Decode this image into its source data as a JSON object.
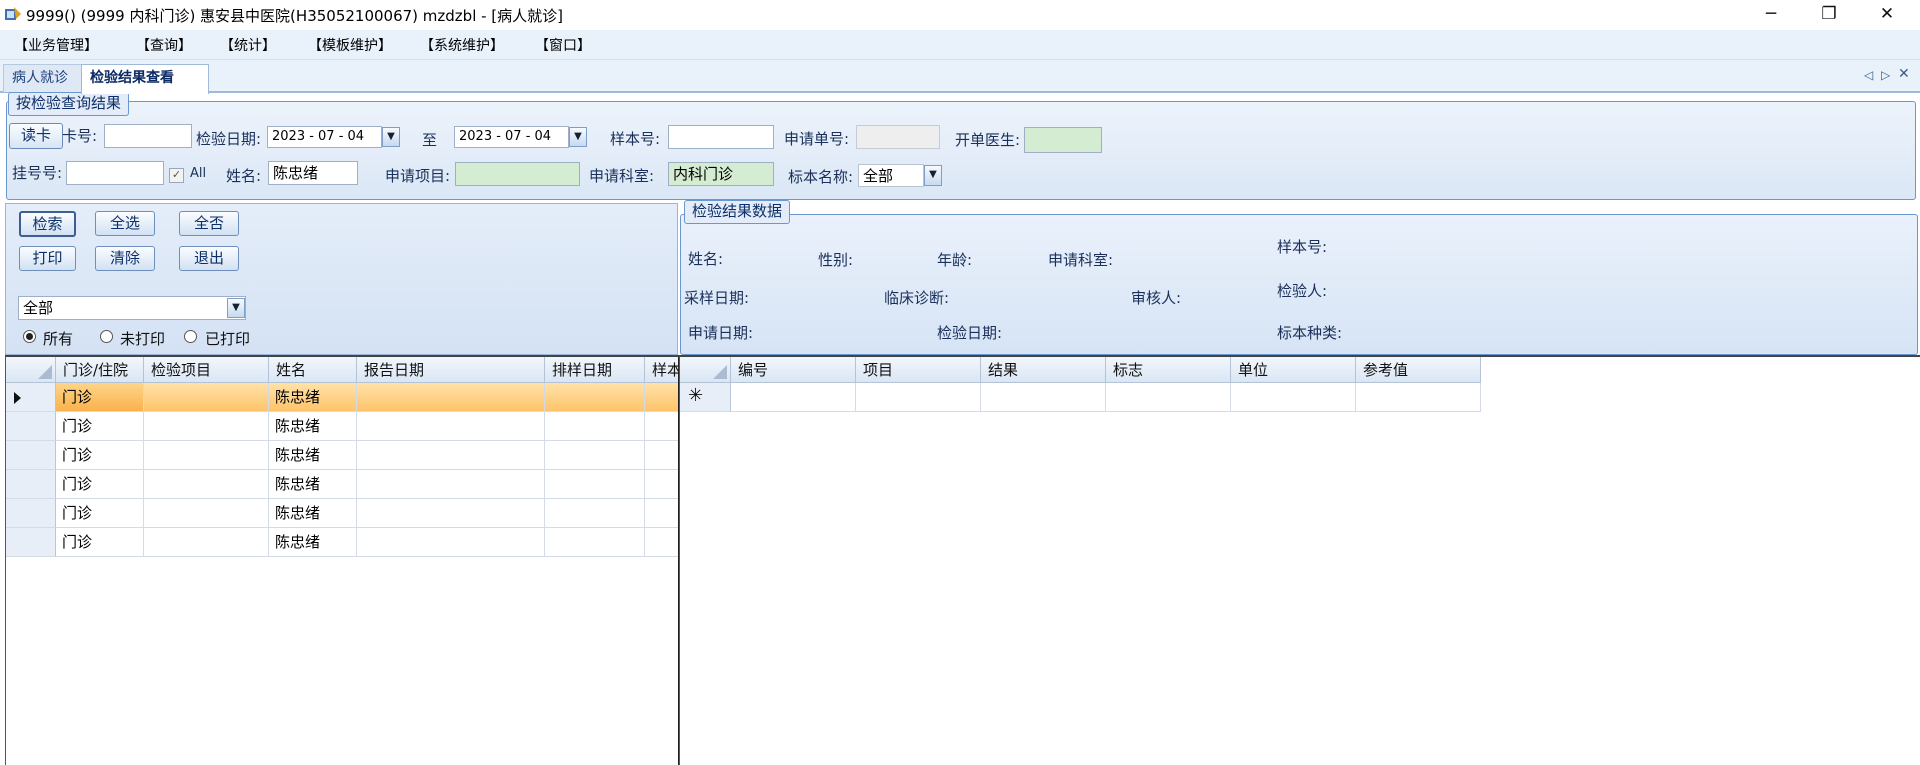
{
  "window": {
    "title": "9999() (9999 内科门诊) 惠安县中医院(H35052100067) mzdzbl - [病人就诊]",
    "minimize_glyph": "─",
    "restore_glyph": "❐",
    "close_glyph": "✕"
  },
  "menu": [
    "【业务管理】",
    "【查询】",
    "【统计】",
    "【模板维护】",
    "【系统维护】",
    "【窗口】"
  ],
  "tabs": {
    "items": [
      "病人就诊",
      "检验结果查看"
    ],
    "active": "检验结果查看",
    "prev_glyph": "◁",
    "next_glyph": "▷",
    "close_glyph": "✕"
  },
  "query": {
    "legend": "按检验查询结果",
    "read_card_label": "读卡",
    "card_no_label": "卡号:",
    "card_no_value": "",
    "date_label": "检验日期:",
    "date_from": "2023 - 07 - 04",
    "to_label": "至",
    "date_to": "2023 - 07 - 04",
    "sample_no_label": "样本号:",
    "sample_no_value": "",
    "request_no_label": "申请单号:",
    "request_no_value": "",
    "doctor_label": "开单医生:",
    "doctor_value": "",
    "reg_no_label": "挂号号:",
    "reg_no_value": "",
    "all_label": "All",
    "all_checked": true,
    "name_label": "姓名:",
    "name_value": "陈忠绪",
    "request_item_label": "申请项目:",
    "request_item_value": "",
    "request_dept_label": "申请科室:",
    "request_dept_value": "内科门诊",
    "specimen_label": "标本名称:",
    "specimen_value": "全部",
    "dropdown_glyph": "▼"
  },
  "actions": {
    "search": "检索",
    "select_all": "全选",
    "select_none": "全否",
    "print": "打印",
    "clear": "清除",
    "exit": "退出"
  },
  "filter": {
    "status_value": "全部",
    "radios": [
      {
        "label": "所有",
        "checked": true
      },
      {
        "label": "未打印",
        "checked": false
      },
      {
        "label": "已打印",
        "checked": false
      }
    ]
  },
  "result_panel": {
    "legend": "检验结果数据",
    "name_label": "姓名:",
    "gender_label": "性别:",
    "age_label": "年龄:",
    "dept_label": "申请科室:",
    "sample_no_label": "样本号:",
    "collect_date_label": "采样日期:",
    "diagnosis_label": "临床诊断:",
    "reviewer_label": "审核人:",
    "tester_label": "检验人:",
    "request_date_label": "申请日期:",
    "test_date_label": "检验日期:",
    "specimen_type_label": "标本种类:"
  },
  "left_grid": {
    "columns": [
      "门诊/住院",
      "检验项目",
      "姓名",
      "报告日期",
      "排样日期",
      "样本"
    ],
    "rows": [
      [
        "门诊",
        "",
        "陈忠绪",
        "",
        "",
        ""
      ],
      [
        "门诊",
        "",
        "陈忠绪",
        "",
        "",
        ""
      ],
      [
        "门诊",
        "",
        "陈忠绪",
        "",
        "",
        ""
      ],
      [
        "门诊",
        "",
        "陈忠绪",
        "",
        "",
        ""
      ],
      [
        "门诊",
        "",
        "陈忠绪",
        "",
        "",
        ""
      ],
      [
        "门诊",
        "",
        "陈忠绪",
        "",
        "",
        ""
      ]
    ],
    "selected_row": 0
  },
  "right_grid": {
    "columns": [
      "编号",
      "项目",
      "结果",
      "标志",
      "单位",
      "参考值"
    ],
    "new_row_marker": "✳"
  }
}
